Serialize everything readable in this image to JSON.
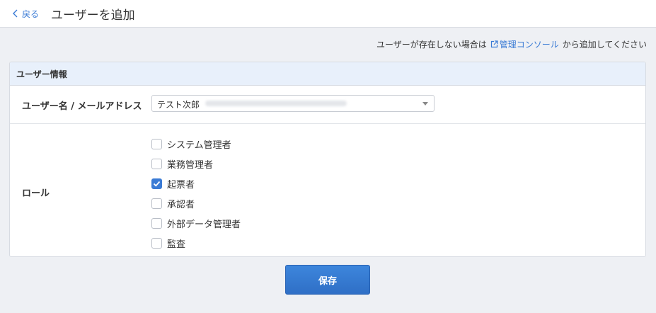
{
  "header": {
    "back_label": "戻る",
    "title": "ユーザーを追加"
  },
  "hint": {
    "prefix": "ユーザーが存在しない場合は",
    "link_label": "管理コンソール",
    "suffix": "から追加してください",
    "link_icon": "external-link-icon"
  },
  "panel": {
    "title": "ユーザー情報",
    "user_field": {
      "label": "ユーザー名 / メールアドレス",
      "selected_value": "テスト次郎"
    },
    "roles": {
      "label": "ロール",
      "options": [
        {
          "label": "システム管理者",
          "checked": false
        },
        {
          "label": "業務管理者",
          "checked": false
        },
        {
          "label": "起票者",
          "checked": true
        },
        {
          "label": "承認者",
          "checked": false
        },
        {
          "label": "外部データ管理者",
          "checked": false
        },
        {
          "label": "監査",
          "checked": false
        }
      ]
    }
  },
  "actions": {
    "save_label": "保存"
  },
  "colors": {
    "accent": "#3a7bd5",
    "background": "#eef0f4",
    "panel_header": "#e8f0fb"
  }
}
